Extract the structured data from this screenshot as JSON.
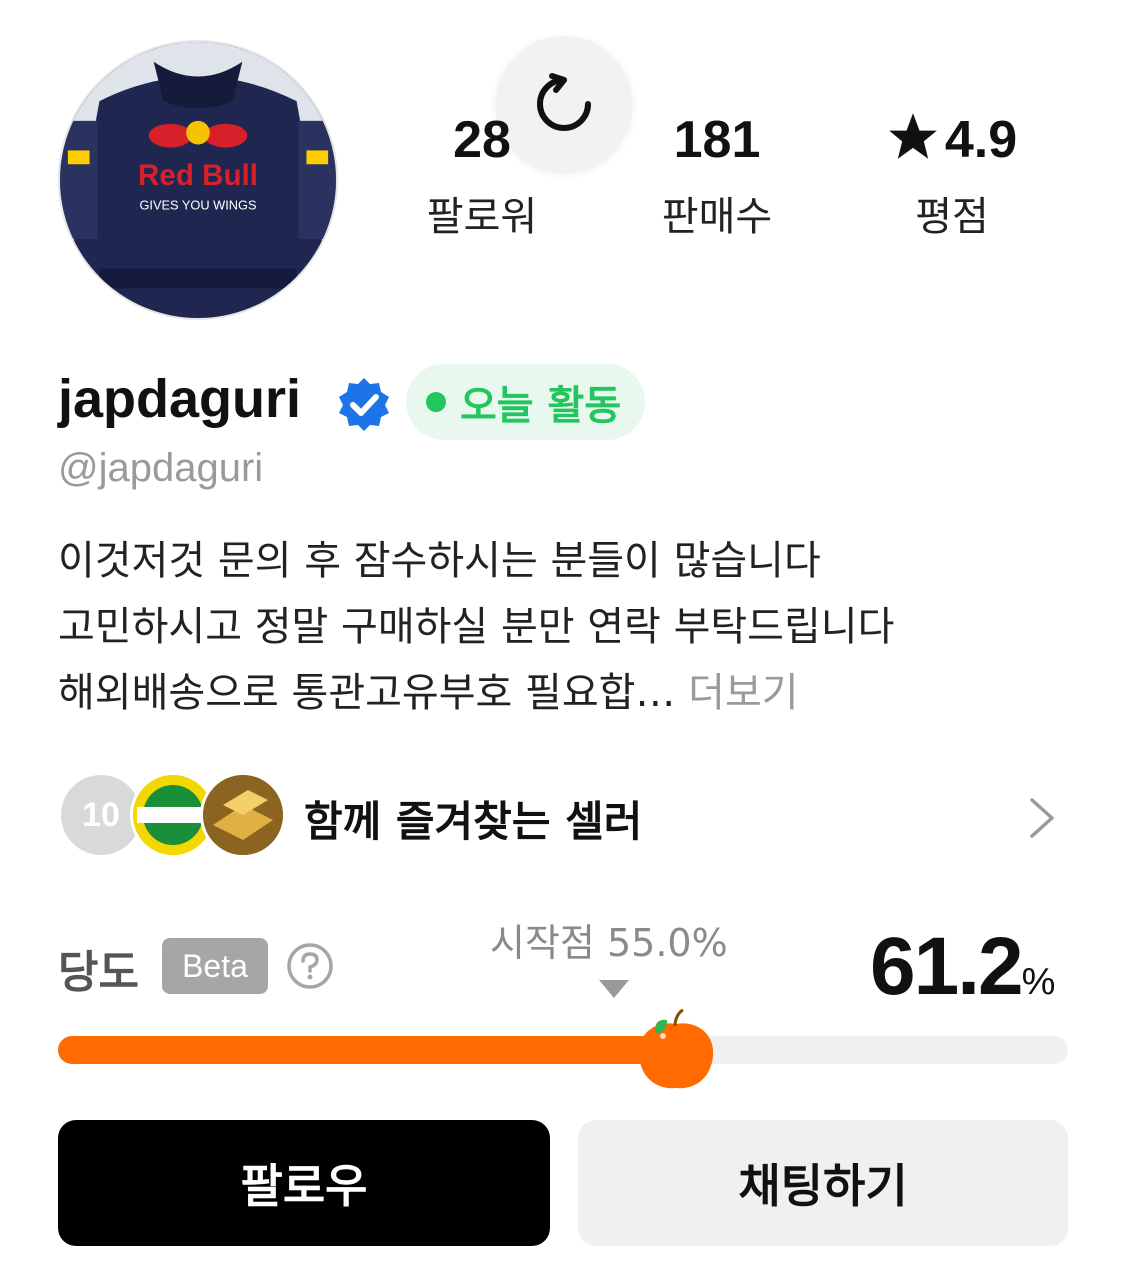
{
  "profile": {
    "username": "japdaguri",
    "handle": "@japdaguri",
    "active_badge": "오늘 활동",
    "avatar_icon": "racing-jacket-photo",
    "verified_icon": "verified-check-icon",
    "bio_line1": "이것저것 문의 후 잠수하시는 분들이 많습니다",
    "bio_line2": "고민하시고 정말 구매하실 분만 연락 부탁드립니다",
    "bio_line3": "해외배송으로 통관고유부호 필요합…",
    "bio_more": "더보기"
  },
  "stats": {
    "followers_value": "28",
    "followers_label": "팔로워",
    "sales_value": "181",
    "sales_label": "판매수",
    "rating_value": "4.9",
    "rating_label": "평점",
    "rating_icon": "star-icon"
  },
  "favorites": {
    "count": "10",
    "title": "함께 즐겨찾는 셀러",
    "chevron_icon": "chevron-right-icon"
  },
  "sweetness": {
    "label": "당도",
    "beta_label": "Beta",
    "start_label": "시작점 55.0%",
    "start_value": 55.0,
    "value_text": "61.2",
    "percent_sign": "%",
    "value": 61.2,
    "fruit_icon": "tangerine-icon",
    "accent_color": "#ff6b00"
  },
  "buttons": {
    "follow": "팔로우",
    "chat": "채팅하기"
  },
  "colors": {
    "active_green": "#22c55e",
    "verified_blue": "#1d74e8"
  }
}
